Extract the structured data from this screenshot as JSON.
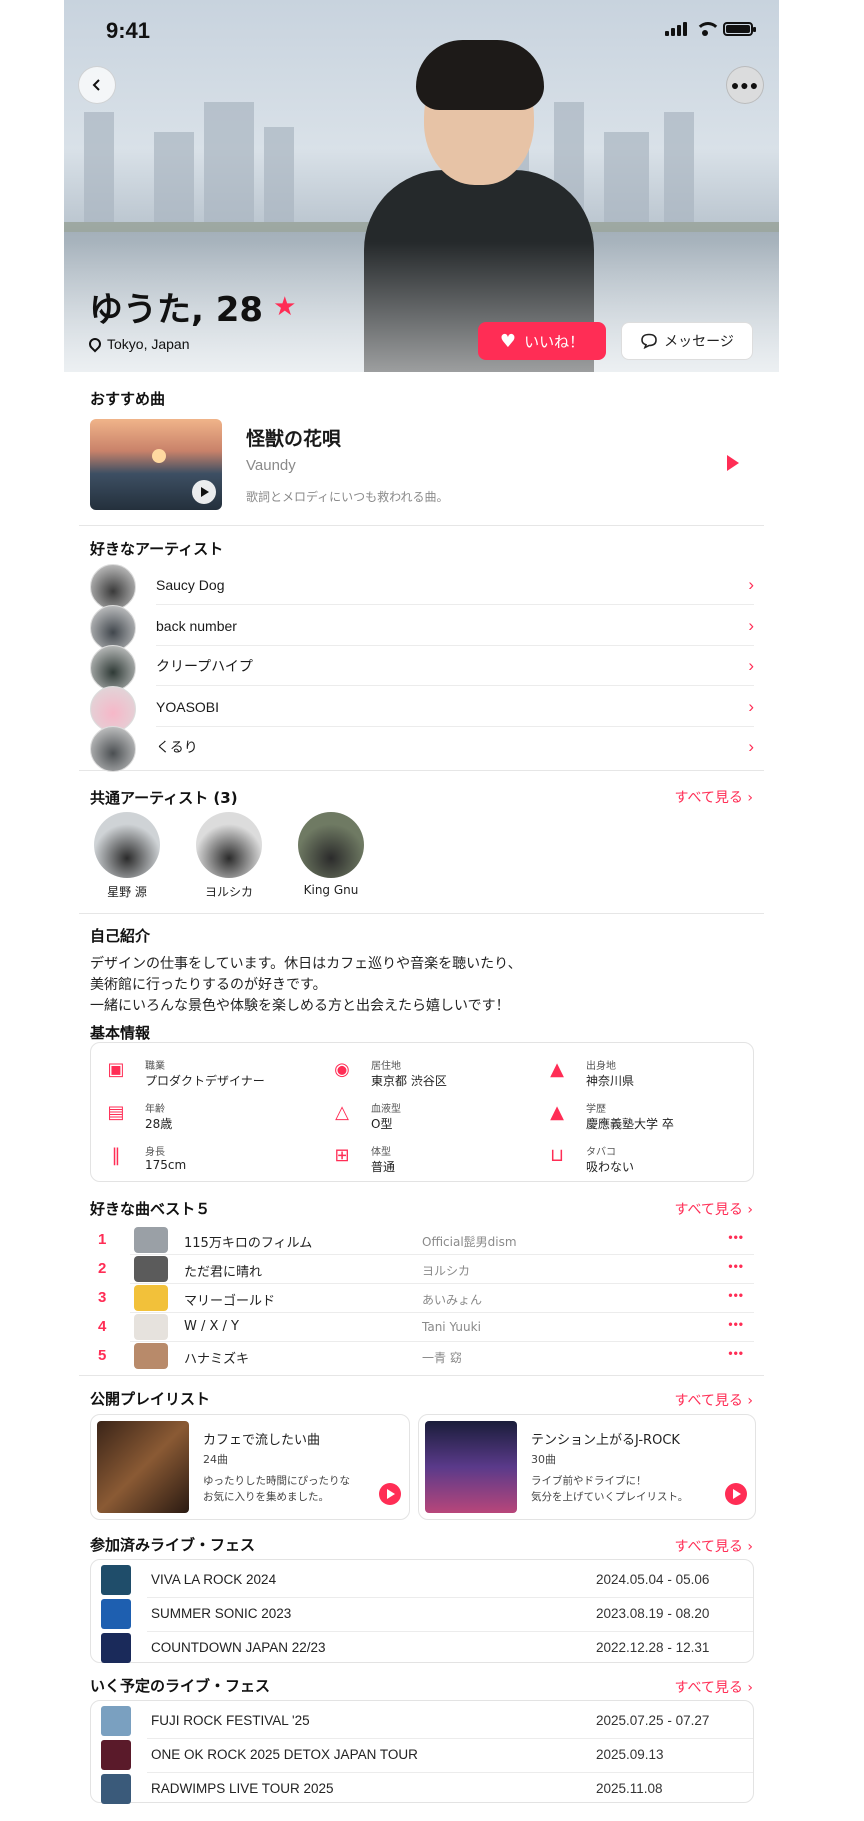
{
  "status": {
    "time": "9:41"
  },
  "profile": {
    "name": "ゆうた, 28",
    "location": "Tokyo, Japan"
  },
  "actions": {
    "like": "いいね！",
    "message": "メッセージ"
  },
  "recommended": {
    "title": "おすすめ曲",
    "song": "怪獣の花唄",
    "artist": "Vaundy",
    "comment": "歌詞とメロディにいつも救われる曲。"
  },
  "fav_artists": {
    "title": "好きなアーティスト",
    "items": [
      "Saucy Dog",
      "back number",
      "クリープハイプ",
      "YOASOBI",
      "くるり"
    ]
  },
  "common_artists": {
    "title": "共通アーティスト (3)",
    "see_all": "すべて見る",
    "items": [
      "星野 源",
      "ヨルシカ",
      "King Gnu"
    ]
  },
  "intro": {
    "title": "自己紹介",
    "lines": [
      "デザインの仕事をしています。休日はカフェ巡りや音楽を聴いたり、",
      "美術館に行ったりするのが好きです。",
      "一緒にいろんな景色や体験を楽しめる方と出会えたら嬉しいです！"
    ]
  },
  "basic": {
    "title": "基本情報",
    "items": [
      {
        "label": "職業",
        "value": "プロダクトデザイナー",
        "icon": "briefcase-icon"
      },
      {
        "label": "居住地",
        "value": "東京都 渋谷区",
        "icon": "location-icon"
      },
      {
        "label": "出身地",
        "value": "神奈川県",
        "icon": "graduation-icon"
      },
      {
        "label": "年齢",
        "value": "28歳",
        "icon": "calendar-icon"
      },
      {
        "label": "血液型",
        "value": "O型",
        "icon": "blood-icon"
      },
      {
        "label": "学歴",
        "value": "慶應義塾大学 卒",
        "icon": "graduation-icon"
      },
      {
        "label": "身長",
        "value": "175cm",
        "icon": "height-icon"
      },
      {
        "label": "体型",
        "value": "普通",
        "icon": "body-icon"
      },
      {
        "label": "タバコ",
        "value": "吸わない",
        "icon": "smoking-icon"
      }
    ]
  },
  "top5": {
    "title": "好きな曲ベスト５",
    "see_all": "すべて見る",
    "items": [
      {
        "rank": "1",
        "song": "115万キロのフィルム",
        "artist": "Official髭男dism"
      },
      {
        "rank": "2",
        "song": "ただ君に晴れ",
        "artist": "ヨルシカ"
      },
      {
        "rank": "3",
        "song": "マリーゴールド",
        "artist": "あいみょん"
      },
      {
        "rank": "4",
        "song": "W / X / Y",
        "artist": "Tani Yuuki"
      },
      {
        "rank": "5",
        "song": "ハナミズキ",
        "artist": "一青 窈"
      }
    ]
  },
  "playlists": {
    "title": "公開プレイリスト",
    "see_all": "すべて見る",
    "items": [
      {
        "name": "カフェで流したい曲",
        "count": "24曲",
        "desc1": "ゆったりした時間にぴったりな",
        "desc2": "お気に入りを集めました。"
      },
      {
        "name": "テンション上がるJ-ROCK",
        "count": "30曲",
        "desc1": "ライブ前やドライブに！",
        "desc2": "気分を上げていくプレイリスト。"
      }
    ]
  },
  "past_lives": {
    "title": "参加済みライブ・フェス",
    "see_all": "すべて見る",
    "items": [
      {
        "name": "VIVA LA ROCK 2024",
        "date": "2024.05.04 - 05.06"
      },
      {
        "name": "SUMMER SONIC 2023",
        "date": "2023.08.19 - 08.20"
      },
      {
        "name": "COUNTDOWN JAPAN 22/23",
        "date": "2022.12.28 - 12.31"
      }
    ]
  },
  "future_lives": {
    "title": "いく予定のライブ・フェス",
    "see_all": "すべて見る",
    "items": [
      {
        "name": "FUJI ROCK FESTIVAL '25",
        "date": "2025.07.25 - 07.27"
      },
      {
        "name": "ONE OK ROCK 2025 DETOX JAPAN TOUR",
        "date": "2025.09.13"
      },
      {
        "name": "RADWIMPS LIVE TOUR 2025",
        "date": "2025.11.08"
      }
    ]
  },
  "colors": {
    "accent": "#ff2d55"
  }
}
